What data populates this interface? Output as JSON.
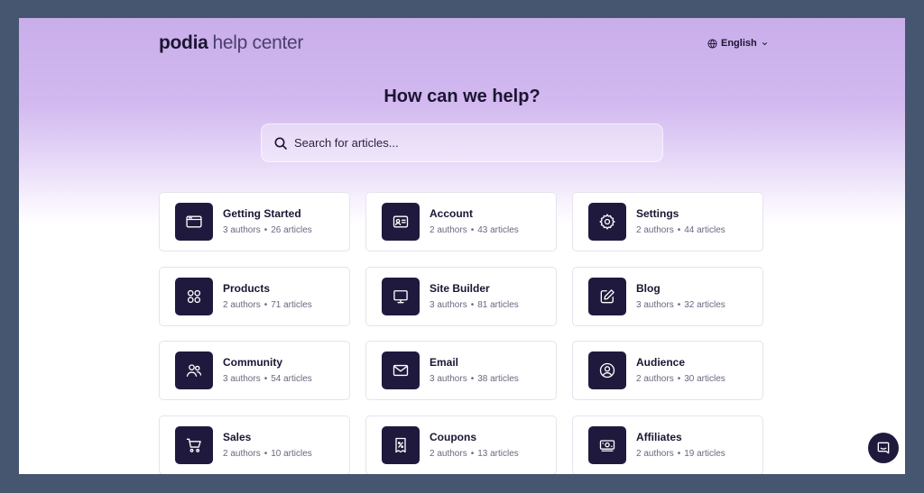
{
  "header": {
    "brand_primary": "podia",
    "brand_secondary": "help center",
    "language_label": "English",
    "globe_icon": "globe-icon",
    "language_chevron_icon": "chevron-down-icon"
  },
  "hero": {
    "title": "How can we help?",
    "search_placeholder": "Search for articles...",
    "search_icon": "search-icon"
  },
  "categories": [
    {
      "title": "Getting Started",
      "authors": "3 authors",
      "articles": "26 articles",
      "icon": "browser-window-icon"
    },
    {
      "title": "Account",
      "authors": "2 authors",
      "articles": "43 articles",
      "icon": "id-card-icon"
    },
    {
      "title": "Settings",
      "authors": "2 authors",
      "articles": "44 articles",
      "icon": "gear-icon"
    },
    {
      "title": "Products",
      "authors": "2 authors",
      "articles": "71 articles",
      "icon": "grid-icon"
    },
    {
      "title": "Site Builder",
      "authors": "3 authors",
      "articles": "81 articles",
      "icon": "monitor-icon"
    },
    {
      "title": "Blog",
      "authors": "3 authors",
      "articles": "32 articles",
      "icon": "pencil-square-icon"
    },
    {
      "title": "Community",
      "authors": "3 authors",
      "articles": "54 articles",
      "icon": "users-icon"
    },
    {
      "title": "Email",
      "authors": "3 authors",
      "articles": "38 articles",
      "icon": "envelope-icon"
    },
    {
      "title": "Audience",
      "authors": "2 authors",
      "articles": "30 articles",
      "icon": "user-circle-icon"
    },
    {
      "title": "Sales",
      "authors": "2 authors",
      "articles": "10 articles",
      "icon": "shopping-cart-icon"
    },
    {
      "title": "Coupons",
      "authors": "2 authors",
      "articles": "13 articles",
      "icon": "receipt-percent-icon"
    },
    {
      "title": "Affiliates",
      "authors": "2 authors",
      "articles": "19 articles",
      "icon": "money-icon"
    }
  ],
  "meta_separator": "•",
  "chat_icon": "chat-bubble-icon",
  "colors": {
    "page_background": "#465670",
    "hero_purple": "#c9aeea",
    "icon_tile": "#1f1a3d",
    "text_dark": "#1b1533",
    "text_muted": "#6b6780"
  }
}
